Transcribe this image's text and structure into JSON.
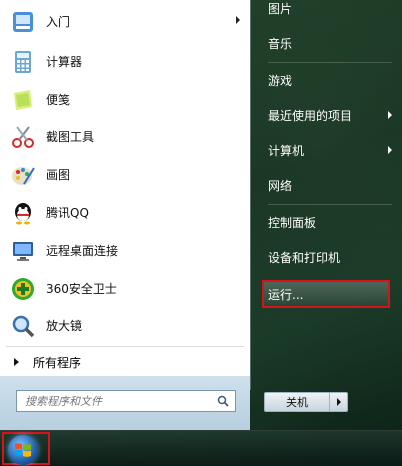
{
  "left_pane": {
    "items": [
      {
        "label": "入门",
        "icon": "getting-started-icon",
        "has_submenu": true
      },
      {
        "label": "计算器",
        "icon": "calculator-icon"
      },
      {
        "label": "便笺",
        "icon": "sticky-notes-icon"
      },
      {
        "label": "截图工具",
        "icon": "snipping-tool-icon"
      },
      {
        "label": "画图",
        "icon": "paint-icon"
      },
      {
        "label": "腾讯QQ",
        "icon": "qq-icon"
      },
      {
        "label": "远程桌面连接",
        "icon": "remote-desktop-icon"
      },
      {
        "label": "360安全卫士",
        "icon": "360-safe-icon"
      },
      {
        "label": "放大镜",
        "icon": "magnifier-icon"
      }
    ],
    "all_programs": "所有程序",
    "search_placeholder": "搜索程序和文件"
  },
  "right_pane": {
    "items": [
      {
        "label": "图片"
      },
      {
        "label": "音乐"
      },
      {
        "label": "游戏"
      },
      {
        "label": "最近使用的项目",
        "has_submenu": true
      },
      {
        "label": "计算机",
        "has_submenu": true
      },
      {
        "label": "网络"
      },
      {
        "label": "控制面板"
      },
      {
        "label": "设备和打印机"
      },
      {
        "label": "运行...",
        "highlighted": true
      }
    ],
    "shutdown_label": "关机"
  },
  "colors": {
    "highlight_border": "#d4141a",
    "left_pane_bg": "#ffffff",
    "right_text": "#ffffff"
  }
}
